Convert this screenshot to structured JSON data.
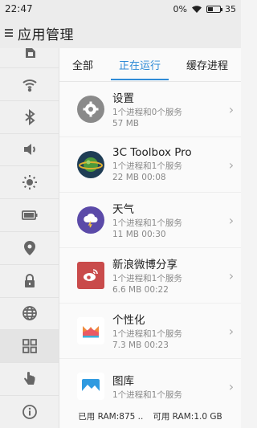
{
  "status_bar": {
    "time": "22:47",
    "signal": "0%",
    "battery": "35",
    "battery_fraction": 0.35
  },
  "header": {
    "title": "应用管理",
    "menu_icon": "menu-icon"
  },
  "sidebar": {
    "items": [
      {
        "name": "sim-card-icon"
      },
      {
        "name": "wifi-icon"
      },
      {
        "name": "bluetooth-icon"
      },
      {
        "name": "sound-icon"
      },
      {
        "name": "brightness-icon"
      },
      {
        "name": "battery-icon"
      },
      {
        "name": "location-icon"
      },
      {
        "name": "lock-icon"
      },
      {
        "name": "globe-icon"
      },
      {
        "name": "apps-grid-icon"
      },
      {
        "name": "gesture-icon"
      },
      {
        "name": "info-icon"
      }
    ]
  },
  "tabs": [
    {
      "label": "全部"
    },
    {
      "label": "正在运行"
    },
    {
      "label": "缓存进程"
    }
  ],
  "apps": [
    {
      "name": "设置",
      "detail": "1个进程和0个服务",
      "meta": "57 MB",
      "icon": "settings-gear-icon",
      "color": "#8a8a8a"
    },
    {
      "name": "3C Toolbox Pro",
      "detail": "1个进程和1个服务",
      "meta": "22 MB  00:08",
      "icon": "toolbox-planet-icon",
      "color": "#2f6b3a"
    },
    {
      "name": "天气",
      "detail": "1个进程和1个服务",
      "meta": "11 MB  00:30",
      "icon": "weather-icon",
      "color": "#5b4aa8"
    },
    {
      "name": "新浪微博分享",
      "detail": "1个进程和1个服务",
      "meta": "6.6 MB  00:22",
      "icon": "weibo-icon",
      "color": "#c94b4b"
    },
    {
      "name": "个性化",
      "detail": "1个进程和1个服务",
      "meta": "7.3 MB  00:23",
      "icon": "personalize-icon",
      "color": "#e8e8e8"
    },
    {
      "name": "图库",
      "detail": "1个进程和1个服务",
      "meta": "",
      "icon": "gallery-icon",
      "color": "#2f9ae0"
    }
  ],
  "footer": {
    "used_ram": "已用 RAM:875 ..",
    "free_ram": "可用 RAM:1.0 GB"
  },
  "colors": {
    "accent": "#2e8bd6"
  }
}
